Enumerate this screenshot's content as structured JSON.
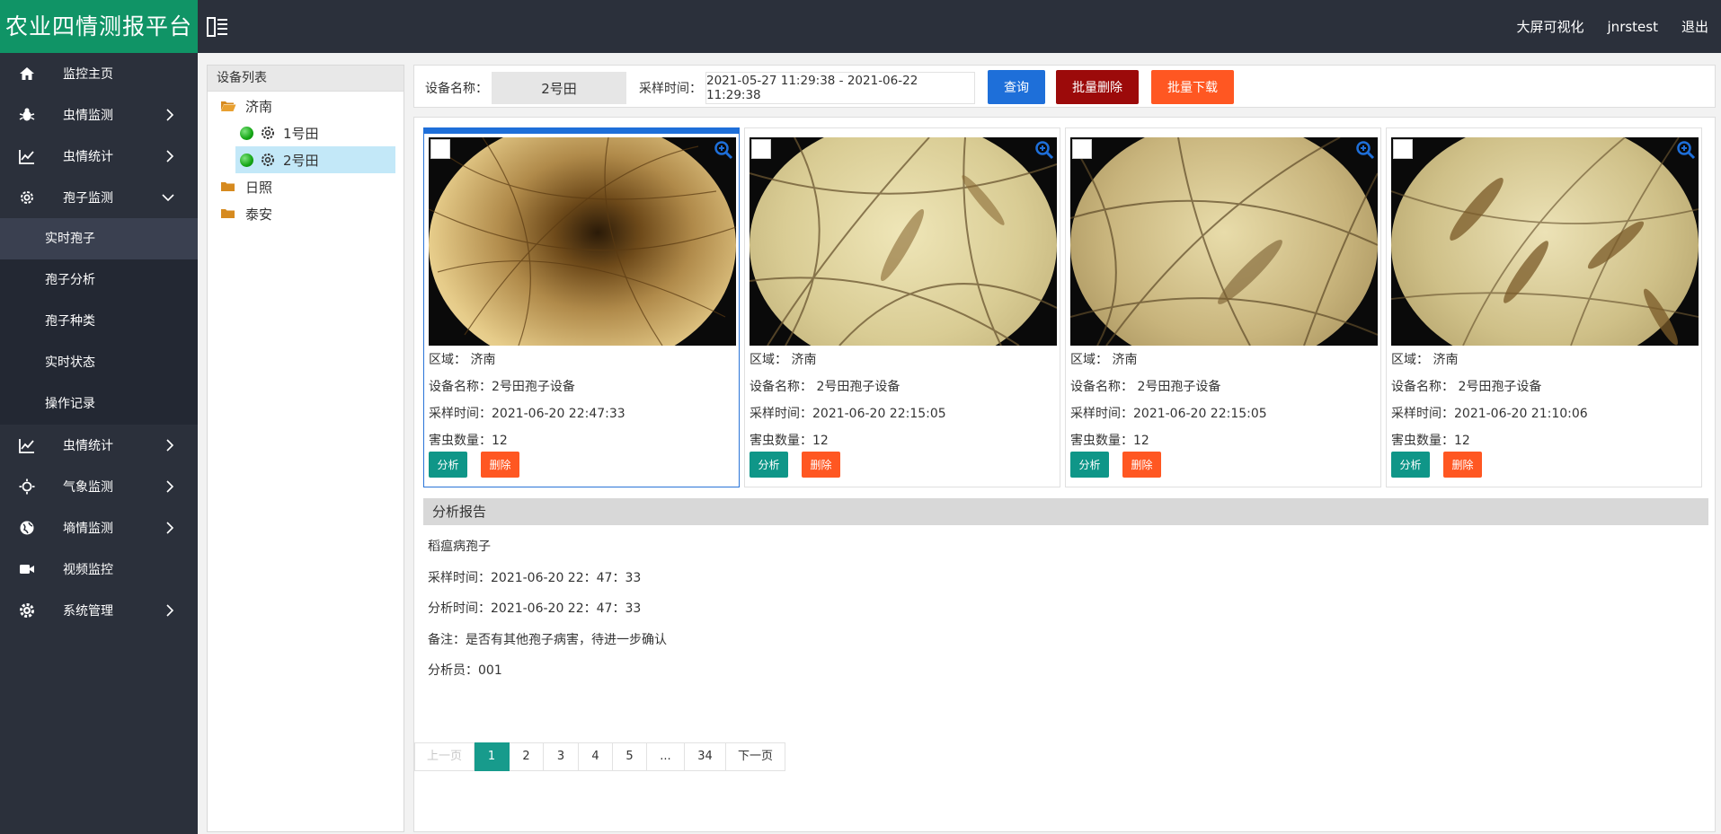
{
  "header": {
    "title": "农业四情测报平台",
    "links": [
      "大屏可视化",
      "jnrstest",
      "退出"
    ]
  },
  "sidebar": {
    "items": [
      {
        "label": "监控主页",
        "icon": "home-icon"
      },
      {
        "label": "虫情监测",
        "icon": "bug-icon"
      },
      {
        "label": "虫情统计",
        "icon": "chart-line-icon"
      },
      {
        "label": "孢子监测",
        "icon": "gear-icon"
      }
    ],
    "subitems": [
      "实时孢子",
      "孢子分析",
      "孢子种类",
      "实时状态",
      "操作记录"
    ],
    "items_after": [
      {
        "label": "虫情统计",
        "icon": "chart-line-icon"
      },
      {
        "label": "气象监测",
        "icon": "sun-icon"
      },
      {
        "label": "墒情监测",
        "icon": "globe-icon"
      },
      {
        "label": "视频监控",
        "icon": "video-icon"
      },
      {
        "label": "系统管理",
        "icon": "cog-icon"
      }
    ]
  },
  "tree": {
    "title": "设备列表",
    "regions": [
      "济南",
      "日照",
      "泰安"
    ],
    "devices": [
      "1号田",
      "2号田"
    ]
  },
  "search": {
    "device_label": "设备名称：",
    "device_value": "2号田",
    "time_label": "采样时间：",
    "time_value": "2021-05-27 11:29:38 - 2021-06-22 11:29:38",
    "query_btn": "查询",
    "batch_delete_btn": "批量删除",
    "batch_download_btn": "批量下载"
  },
  "cards": [
    {
      "region": "区域： 济南",
      "device": "设备名称：2号田孢子设备",
      "time": "采样时间：2021-06-20 22:47:33",
      "count": "害虫数量：12"
    },
    {
      "region": "区域： 济南",
      "device": "设备名称： 2号田孢子设备",
      "time": "采样时间：2021-06-20 22:15:05",
      "count": "害虫数量：12"
    },
    {
      "region": "区域： 济南",
      "device": "设备名称： 2号田孢子设备",
      "time": "采样时间：2021-06-20 22:15:05",
      "count": "害虫数量：12"
    },
    {
      "region": "区域： 济南",
      "device": "设备名称： 2号田孢子设备",
      "time": "采样时间：2021-06-20 21:10:06",
      "count": "害虫数量：12"
    }
  ],
  "card_buttons": {
    "analyze": "分析",
    "delete": "删除"
  },
  "report": {
    "title": "分析报告",
    "lines": [
      "稻瘟病孢子",
      "采样时间：2021-06-20 22：47：33",
      "分析时间：2021-06-20 22：47：33",
      "备注：是否有其他孢子病害，待进一步确认",
      "分析员：001"
    ]
  },
  "pagination": [
    "上一页",
    "1",
    "2",
    "3",
    "4",
    "5",
    "...",
    "34",
    "下一页"
  ],
  "colors": {
    "brand": "#109466",
    "header": "#2b303b",
    "query": "#1e6fd9",
    "batch_delete": "#9c0a0a",
    "batch_download": "#ff5722",
    "analyze": "#0f9688",
    "delete": "#ff5722",
    "current_page": "#179b8c"
  }
}
